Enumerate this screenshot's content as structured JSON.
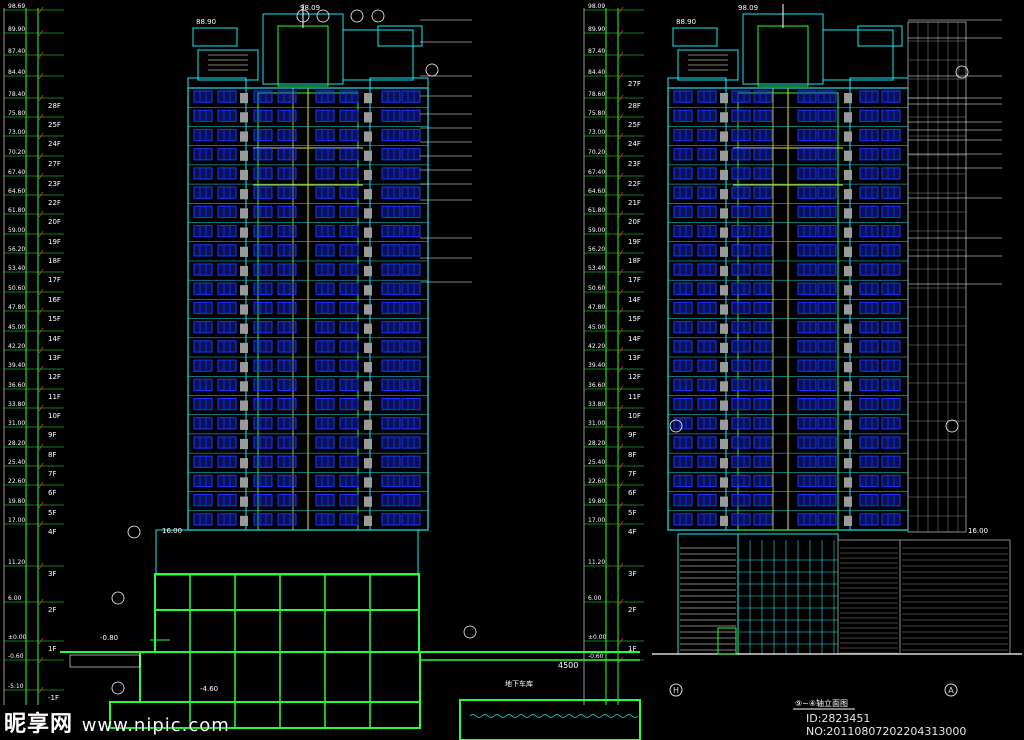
{
  "watermark": {
    "brand": "昵享网",
    "url": "www.nipic.com"
  },
  "image_id": "ID:2823451 NO:20110807202204313000",
  "elevations_left": [
    {
      "v": "98.69"
    },
    {
      "v": "89.90",
      "f": ""
    },
    {
      "v": "87.40"
    },
    {
      "v": "84.40"
    },
    {
      "v": "78.40",
      "f": "28F"
    },
    {
      "v": "75.80",
      "f": "25F"
    },
    {
      "v": "73.00",
      "f": "24F"
    },
    {
      "v": "70.20",
      "f": "27F"
    },
    {
      "v": "67.40",
      "f": "23F"
    },
    {
      "v": "64.60",
      "f": "22F"
    },
    {
      "v": "61.80",
      "f": "20F"
    },
    {
      "v": "59.00",
      "f": "19F"
    },
    {
      "v": "56.20",
      "f": "18F"
    },
    {
      "v": "53.40",
      "f": "17F"
    },
    {
      "v": "50.60",
      "f": "16F"
    },
    {
      "v": "47.80",
      "f": "15F"
    },
    {
      "v": "45.00",
      "f": "14F"
    },
    {
      "v": "42.20",
      "f": "13F"
    },
    {
      "v": "39.40",
      "f": "12F"
    },
    {
      "v": "36.60",
      "f": "11F"
    },
    {
      "v": "33.80",
      "f": "10F"
    },
    {
      "v": "31.00",
      "f": "9F"
    },
    {
      "v": "28.20",
      "f": "8F"
    },
    {
      "v": "25.40",
      "f": "7F"
    },
    {
      "v": "22.60",
      "f": "6F"
    },
    {
      "v": "19.80",
      "f": "5F"
    },
    {
      "v": "17.00",
      "f": "4F"
    },
    {
      "v": "11.20",
      "f": "3F"
    },
    {
      "v": "6.00",
      "f": "2F"
    },
    {
      "v": "±0.00",
      "f": "1F"
    },
    {
      "v": "-0.60"
    },
    {
      "v": "-5.10",
      "f": "-1F"
    }
  ],
  "elevations_right": [
    {
      "v": "98.09"
    },
    {
      "v": "89.90"
    },
    {
      "v": "87.40"
    },
    {
      "v": "84.40",
      "f": "27F"
    },
    {
      "v": "78.60",
      "f": "28F"
    },
    {
      "v": "75.80",
      "f": "25F"
    },
    {
      "v": "73.00",
      "f": "24F"
    },
    {
      "v": "70.20",
      "f": "23F"
    },
    {
      "v": "67.40",
      "f": "22F"
    },
    {
      "v": "64.60",
      "f": "21F"
    },
    {
      "v": "61.80",
      "f": "20F"
    },
    {
      "v": "59.00",
      "f": "19F"
    },
    {
      "v": "56.20",
      "f": "18F"
    },
    {
      "v": "53.40",
      "f": "17F"
    },
    {
      "v": "50.60",
      "f": "14F"
    },
    {
      "v": "47.80",
      "f": "15F"
    },
    {
      "v": "45.00",
      "f": "14F"
    },
    {
      "v": "42.20",
      "f": "13F"
    },
    {
      "v": "39.40",
      "f": "12F"
    },
    {
      "v": "36.60",
      "f": "11F"
    },
    {
      "v": "33.80",
      "f": "10F"
    },
    {
      "v": "31.00",
      "f": "9F"
    },
    {
      "v": "28.20",
      "f": "8F"
    },
    {
      "v": "25.40",
      "f": "7F"
    },
    {
      "v": "22.60",
      "f": "6F"
    },
    {
      "v": "19.80",
      "f": "5F"
    },
    {
      "v": "17.00",
      "f": "4F"
    },
    {
      "v": "11.20",
      "f": "3F"
    },
    {
      "v": "6.00",
      "f": "2F"
    },
    {
      "v": "±0.00",
      "f": "1F"
    },
    {
      "v": "-0.60"
    }
  ],
  "top_elev_left": "98.09",
  "top_elev_right": "98.09",
  "parapet_elev_left": "88.90",
  "parapet_elev_right": "88.90",
  "podium_elev_left": "16.00",
  "podium_elev_right": "16.00",
  "section_labels": {
    "left_bottom": "-4.60",
    "dim_4500": "4500",
    "elev_980": "-0.80",
    "garage": "地下车库"
  },
  "grid_markers": {
    "left": "H",
    "right": "A"
  },
  "drawing_title": "⑨~④轴立面图",
  "colors": {
    "cyan": "#19e6f0",
    "green": "#22ff33",
    "yellow": "#e6e600",
    "blue": "#1a34ff",
    "white": "#ffffff",
    "gray": "#8a8a8a",
    "red": "#ff2020"
  }
}
